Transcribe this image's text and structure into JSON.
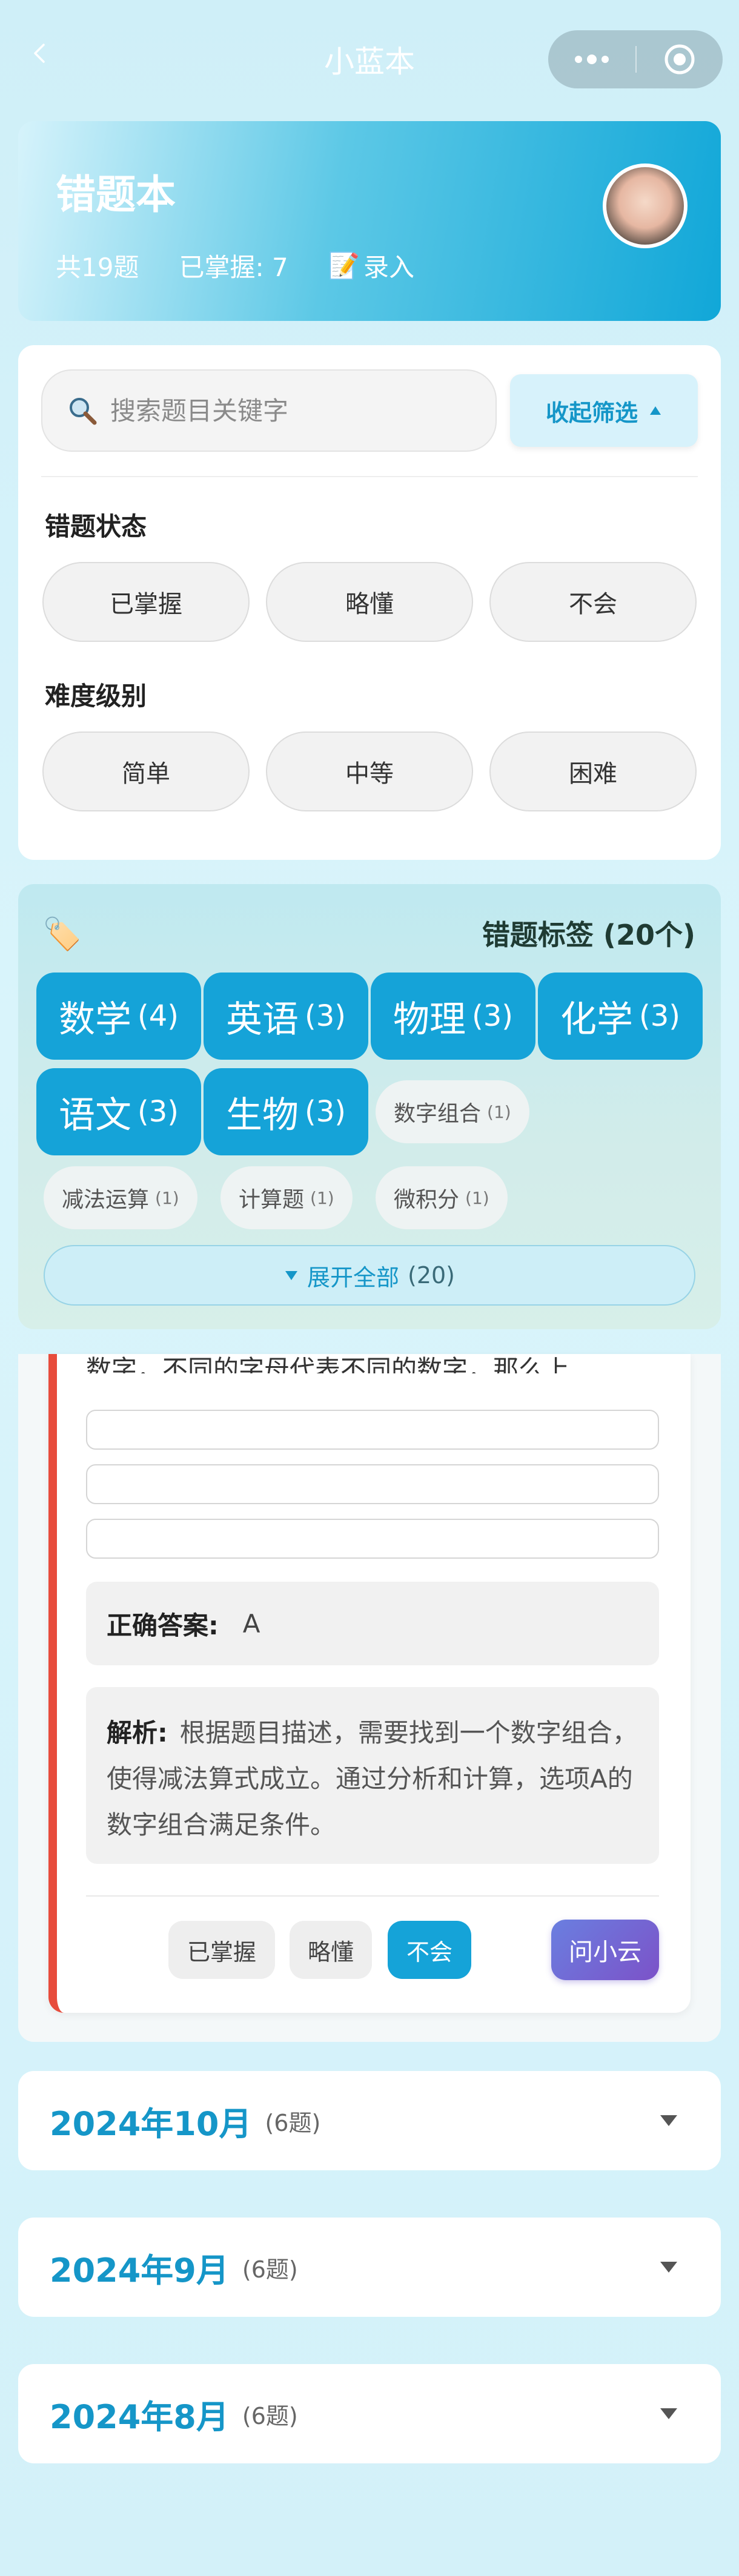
{
  "nav": {
    "title": "小蓝本"
  },
  "header": {
    "title": "错题本",
    "total": "共19题",
    "mastered": "已掌握: 7",
    "record_icon": "📝",
    "record_label": "录入"
  },
  "search": {
    "placeholder": "搜索题目关键字",
    "value": ""
  },
  "filter": {
    "collapse_label": "收起筛选",
    "status_title": "错题状态",
    "status_options": [
      "已掌握",
      "略懂",
      "不会"
    ],
    "difficulty_title": "难度级别",
    "difficulty_options": [
      "简单",
      "中等",
      "困难"
    ]
  },
  "tags": {
    "icon": "🏷️",
    "title": "错题标签 (20个)",
    "big": [
      {
        "name": "数学",
        "count": "(4)"
      },
      {
        "name": "英语",
        "count": "(3)"
      },
      {
        "name": "物理",
        "count": "(3)"
      },
      {
        "name": "化学",
        "count": "(3)"
      },
      {
        "name": "语文",
        "count": "(3)"
      },
      {
        "name": "生物",
        "count": "(3)"
      }
    ],
    "small": [
      {
        "name": "数字组合",
        "count": "(1)"
      },
      {
        "name": "减法运算",
        "count": "(1)"
      },
      {
        "name": "计算题",
        "count": "(1)"
      },
      {
        "name": "微积分",
        "count": "(1)"
      }
    ],
    "expand_label": "展开全部",
    "expand_count": "(20)"
  },
  "question": {
    "text": "数字，不同的字母代表不同的数字，那么上",
    "answer_label": "正确答案:",
    "answer_value": "A",
    "analysis_label": "解析:",
    "analysis_text": "根据题目描述，需要找到一个数字组合，使得减法算式成立。通过分析和计算，选项A的数字组合满足条件。",
    "status_mastered": "已掌握",
    "status_partial": "略懂",
    "status_unknown": "不会",
    "ask_label": "问小云"
  },
  "months": [
    {
      "title": "2024年10月",
      "count": "(6题)"
    },
    {
      "title": "2024年9月",
      "count": "(6题)"
    },
    {
      "title": "2024年8月",
      "count": "(6题)"
    }
  ],
  "colors": {
    "accent": "#15a3d8",
    "danger": "#e74c3c",
    "ask_gradient_start": "#6a7fe0",
    "ask_gradient_end": "#7c52c8"
  }
}
